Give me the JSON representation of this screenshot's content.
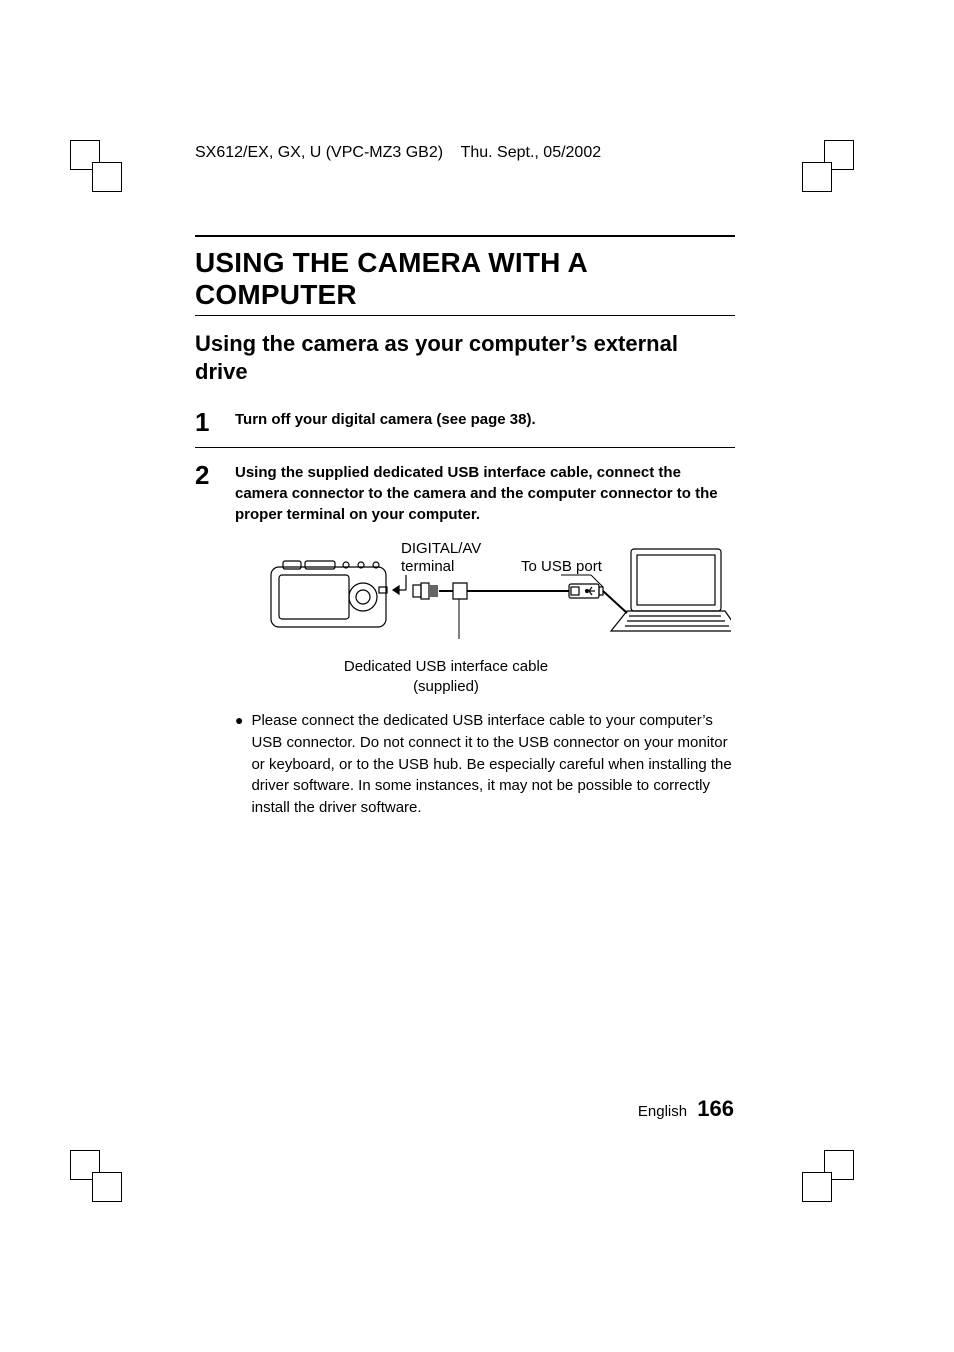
{
  "header": {
    "doc_id": "SX612/EX, GX, U (VPC-MZ3 GB2)",
    "date": "Thu. Sept., 05/2002"
  },
  "title": "USING THE CAMERA WITH A COMPUTER",
  "subtitle": "Using the camera as your computer’s external drive",
  "steps": [
    {
      "num": "1",
      "text": "Turn off your digital camera (see page 38)."
    },
    {
      "num": "2",
      "text": "Using the supplied dedicated USB interface cable, connect the camera connector to the camera and the computer connector to the proper terminal on your computer."
    }
  ],
  "figure": {
    "label_terminal_1": "DIGITAL/AV",
    "label_terminal_2": "terminal",
    "label_usb": "To USB port",
    "caption_1": "Dedicated USB interface cable",
    "caption_2": "(supplied)"
  },
  "note": "Please connect the dedicated USB interface cable to your computer’s USB connector. Do not connect it to the USB connector on your monitor or keyboard, or to the USB hub. Be especially careful when installing the driver software. In some instances, it may not be possible to correctly install the driver software.",
  "footer": {
    "lang": "English",
    "page": "166"
  }
}
